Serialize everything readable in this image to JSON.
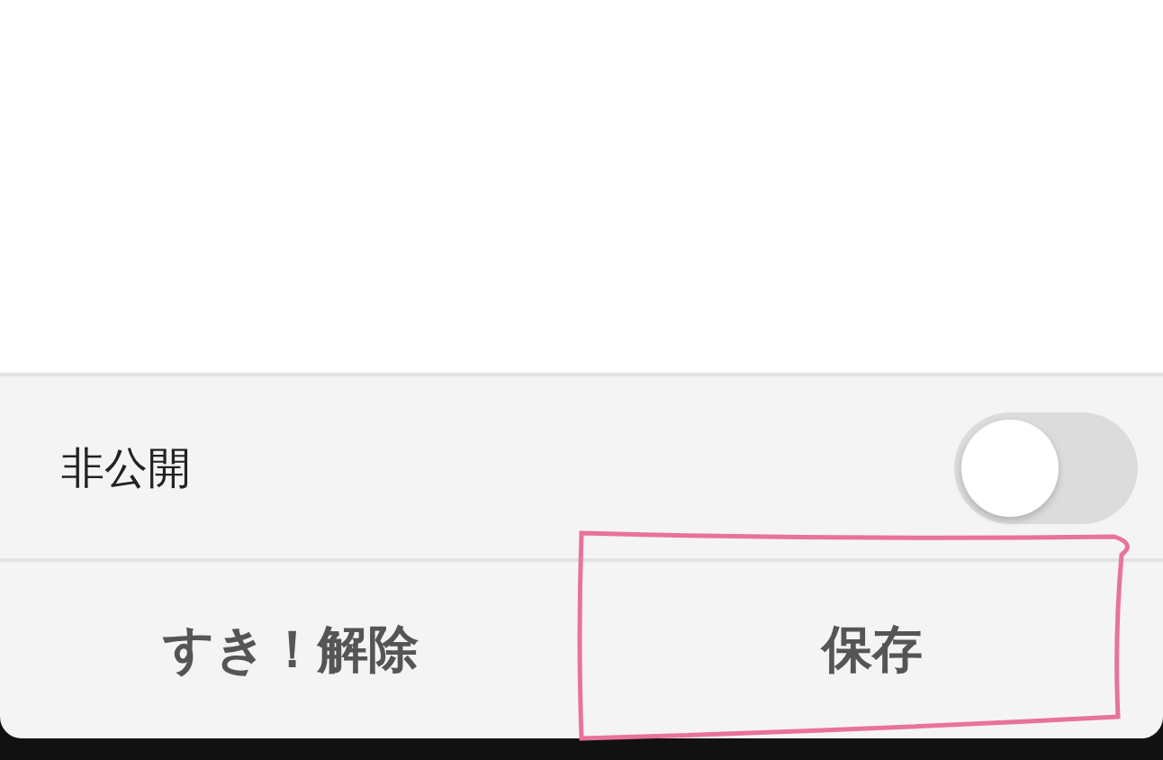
{
  "privacy": {
    "label": "非公開",
    "on": false
  },
  "buttons": [
    {
      "label": "すき！解除",
      "highlighted": false
    },
    {
      "label": "保存",
      "highlighted": true
    }
  ]
}
